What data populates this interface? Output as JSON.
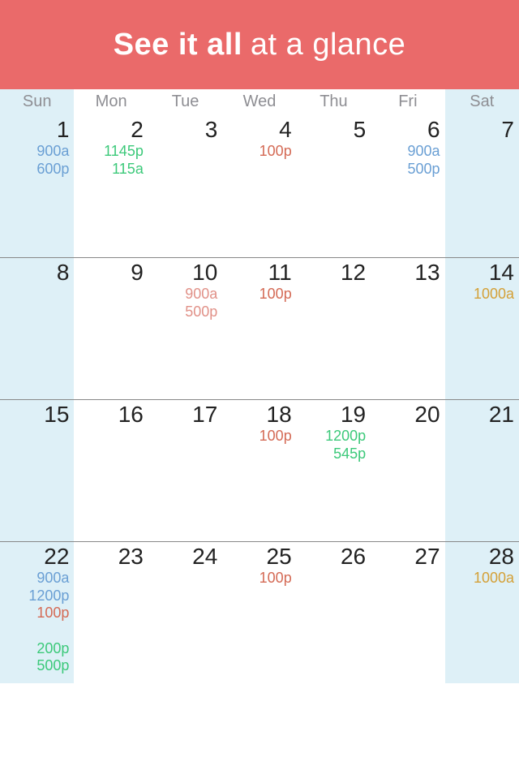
{
  "header": {
    "title_bold": "See it all",
    "title_light": "at a glance"
  },
  "weekdays": [
    "Sun",
    "Mon",
    "Tue",
    "Wed",
    "Thu",
    "Fri",
    "Sat"
  ],
  "colors": {
    "blue": "#6a9fd4",
    "green": "#3cc97a",
    "red": "#d46a55",
    "salmon": "#e19188",
    "gold": "#d4a037"
  },
  "month_grid": [
    [
      {
        "day": 1,
        "events": [
          {
            "t": "900a",
            "c": "blue"
          },
          {
            "t": "600p",
            "c": "blue"
          }
        ]
      },
      {
        "day": 2,
        "events": [
          {
            "t": "1145p",
            "c": "green"
          },
          {
            "t": "115a",
            "c": "green"
          }
        ]
      },
      {
        "day": 3,
        "events": []
      },
      {
        "day": 4,
        "events": [
          {
            "t": "100p",
            "c": "red"
          }
        ]
      },
      {
        "day": 5,
        "events": []
      },
      {
        "day": 6,
        "events": [
          {
            "t": "900a",
            "c": "blue"
          },
          {
            "t": "500p",
            "c": "blue"
          }
        ]
      },
      {
        "day": 7,
        "events": []
      }
    ],
    [
      {
        "day": 8,
        "events": []
      },
      {
        "day": 9,
        "events": []
      },
      {
        "day": 10,
        "events": [
          {
            "t": "900a",
            "c": "salmon"
          },
          {
            "t": "500p",
            "c": "salmon"
          }
        ]
      },
      {
        "day": 11,
        "events": [
          {
            "t": "100p",
            "c": "red"
          }
        ]
      },
      {
        "day": 12,
        "events": []
      },
      {
        "day": 13,
        "events": []
      },
      {
        "day": 14,
        "events": [
          {
            "t": "1000a",
            "c": "gold"
          }
        ]
      }
    ],
    [
      {
        "day": 15,
        "events": []
      },
      {
        "day": 16,
        "events": []
      },
      {
        "day": 17,
        "events": []
      },
      {
        "day": 18,
        "events": [
          {
            "t": "100p",
            "c": "red"
          }
        ]
      },
      {
        "day": 19,
        "events": [
          {
            "t": "1200p",
            "c": "green"
          },
          {
            "t": "545p",
            "c": "green"
          }
        ]
      },
      {
        "day": 20,
        "events": []
      },
      {
        "day": 21,
        "events": []
      }
    ],
    [
      {
        "day": 22,
        "events": [
          {
            "t": "900a",
            "c": "blue"
          },
          {
            "t": "1200p",
            "c": "blue"
          },
          {
            "t": "100p",
            "c": "red"
          },
          {
            "t": "",
            "c": "red"
          },
          {
            "t": "200p",
            "c": "green"
          },
          {
            "t": "500p",
            "c": "green"
          }
        ]
      },
      {
        "day": 23,
        "events": []
      },
      {
        "day": 24,
        "events": []
      },
      {
        "day": 25,
        "events": [
          {
            "t": "100p",
            "c": "red"
          }
        ]
      },
      {
        "day": 26,
        "events": []
      },
      {
        "day": 27,
        "events": []
      },
      {
        "day": 28,
        "events": [
          {
            "t": "1000a",
            "c": "gold"
          }
        ]
      }
    ]
  ]
}
